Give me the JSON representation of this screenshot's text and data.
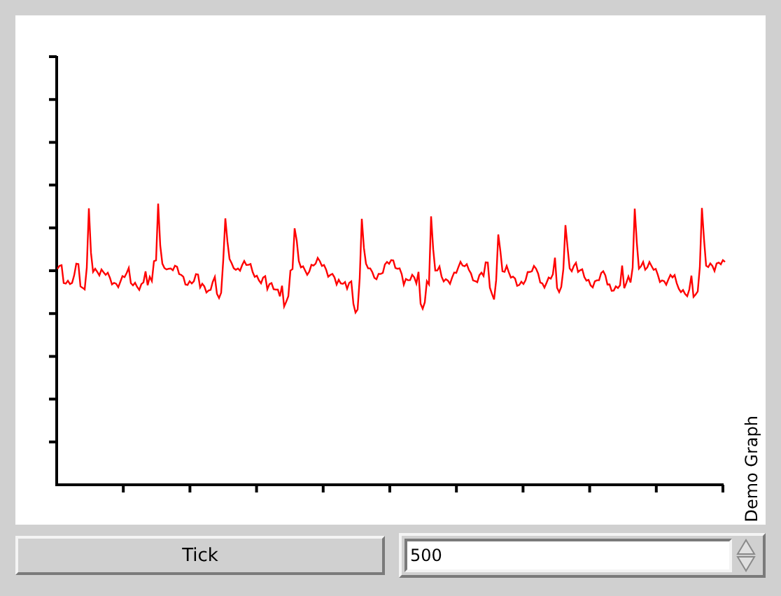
{
  "graph": {
    "title": "Demo Graph"
  },
  "tick_button": {
    "label": "Tick"
  },
  "spinner": {
    "value": "500"
  }
}
